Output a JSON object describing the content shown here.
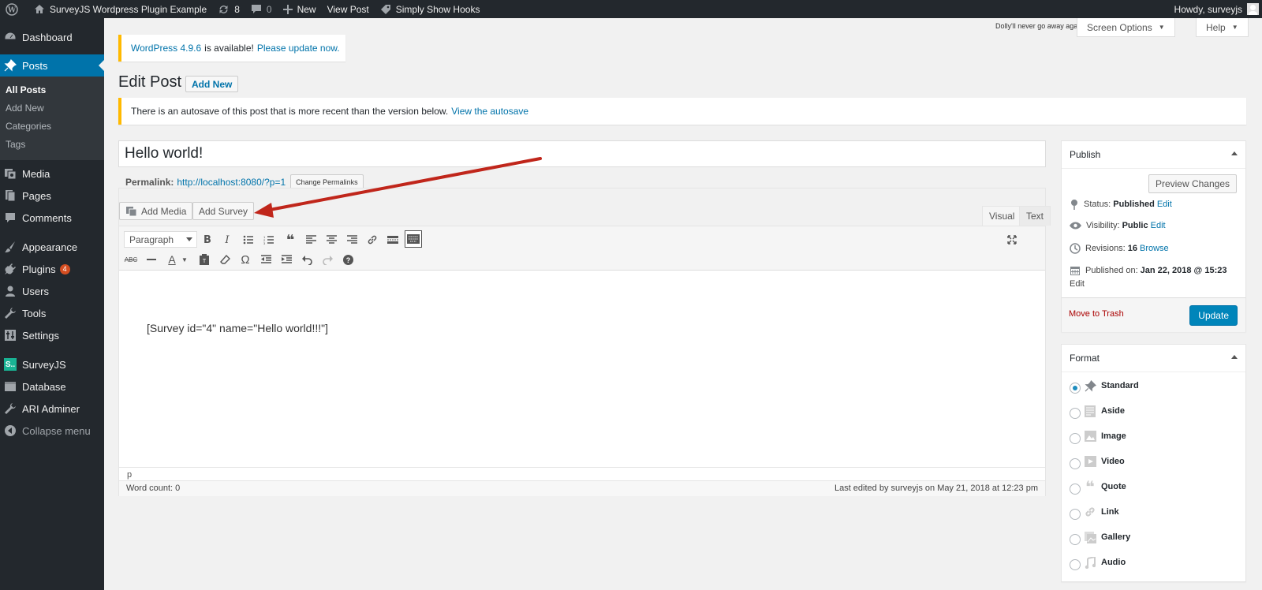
{
  "adminbar": {
    "site_name": "SurveyJS Wordpress Plugin Example",
    "updates_count": "8",
    "comments_count": "0",
    "new_label": "New",
    "view_post": "View Post",
    "hooks_label": "Simply Show Hooks",
    "howdy": "Howdy, surveyjs"
  },
  "sidebar": {
    "items": [
      {
        "label": "Dashboard",
        "icon": "dashboard-icon"
      },
      {
        "label": "Posts",
        "icon": "pin-icon"
      },
      {
        "label": "Media",
        "icon": "media-icon"
      },
      {
        "label": "Pages",
        "icon": "pages-icon"
      },
      {
        "label": "Comments",
        "icon": "comments-icon"
      },
      {
        "label": "Appearance",
        "icon": "appearance-icon"
      },
      {
        "label": "Plugins",
        "icon": "plugins-icon",
        "badge": "4"
      },
      {
        "label": "Users",
        "icon": "users-icon"
      },
      {
        "label": "Tools",
        "icon": "tools-icon"
      },
      {
        "label": "Settings",
        "icon": "settings-icon"
      },
      {
        "label": "SurveyJS",
        "icon": "surveyjs-icon",
        "logo_text": "S.."
      },
      {
        "label": "Database",
        "icon": "database-icon"
      },
      {
        "label": "ARI Adminer",
        "icon": "wrench-icon"
      },
      {
        "label": "Collapse menu",
        "icon": "collapse-icon"
      }
    ],
    "posts_submenu": [
      "All Posts",
      "Add New",
      "Categories",
      "Tags"
    ]
  },
  "notices": {
    "update_version": "WordPress 4.9.6",
    "update_middle": "is available!",
    "update_link": "Please update now.",
    "autosave_text": "There is an autosave of this post that is more recent than the version below.",
    "autosave_link": "View the autosave"
  },
  "header": {
    "dolly": "Dolly'll never go away again",
    "screen_options": "Screen Options",
    "help": "Help",
    "title": "Edit Post",
    "add_new": "Add New"
  },
  "post": {
    "title": "Hello world!",
    "permalink_label": "Permalink:",
    "permalink_url": "http://localhost:8080/?p=1",
    "change_permalinks": "Change Permalinks",
    "content": "[Survey id=\"4\" name=\"Hello world!!!\"]"
  },
  "editor": {
    "add_media": "Add Media",
    "add_survey": "Add Survey",
    "tab_visual": "Visual",
    "tab_text": "Text",
    "format_select": "Paragraph",
    "path": "p",
    "word_count": "Word count: 0",
    "last_edited": "Last edited by surveyjs on May 21, 2018 at 12:23 pm"
  },
  "publish": {
    "title": "Publish",
    "preview": "Preview Changes",
    "status_label": "Status:",
    "status_value": "Published",
    "visibility_label": "Visibility:",
    "visibility_value": "Public",
    "revisions_label": "Revisions:",
    "revisions_value": "16",
    "browse": "Browse",
    "published_label": "Published on:",
    "published_value": "Jan 22, 2018 @ 15:23",
    "edit": "Edit",
    "trash": "Move to Trash",
    "update": "Update"
  },
  "format": {
    "title": "Format",
    "options": [
      "Standard",
      "Aside",
      "Image",
      "Video",
      "Quote",
      "Link",
      "Gallery",
      "Audio"
    ],
    "selected": "Standard"
  },
  "colors": {
    "admin_dark": "#23282d",
    "accent": "#0073aa",
    "notice_warning": "#ffb900",
    "annotation_arrow": "#c0261b"
  }
}
